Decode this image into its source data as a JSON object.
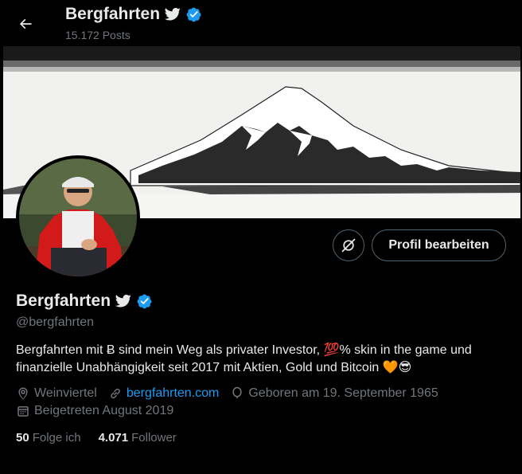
{
  "header": {
    "name": "Bergfahrten",
    "posts": "15.172 Posts"
  },
  "profile": {
    "display_name": "Bergfahrten",
    "handle": "@bergfahrten",
    "edit_button": "Profil bearbeiten",
    "bio_part1": "Bergfahrten mit Ƀ sind mein Weg als privater Investor, ",
    "bio_emoji_hundred": "💯",
    "bio_part2": "% skin in the game und finanzielle Unabhängigkeit seit 2017 mit Aktien, Gold und Bitcoin ",
    "bio_emoji_heart": "🧡",
    "bio_emoji_cool": "😎",
    "location": "Weinviertel",
    "website": "bergfahrten.com",
    "birthday": "Geboren am 19. September 1965",
    "joined": "Beigetreten August 2019",
    "following_count": "50",
    "following_label": "Folge ich",
    "followers_count": "4.071",
    "followers_label": "Follower"
  },
  "colors": {
    "accent": "#1d9bf0",
    "muted": "#71767b",
    "text": "#e7e9ea",
    "background": "#000000"
  },
  "icons": [
    "back-arrow-icon",
    "twitter-bird-icon",
    "verified-badge-icon",
    "sync-icon",
    "location-pin-icon",
    "link-icon",
    "balloon-icon",
    "calendar-icon"
  ]
}
